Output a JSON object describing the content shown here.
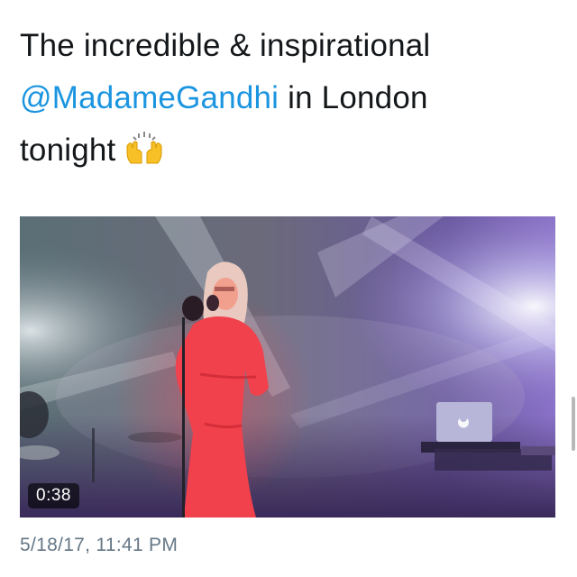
{
  "tweet": {
    "text_part1": "The incredible & inspirational",
    "mention": "@MadameGandhi",
    "text_part2": " in London",
    "text_part3": "tonight",
    "emoji_icon": "raised-hands-icon"
  },
  "media": {
    "type": "video",
    "duration": "0:38"
  },
  "timestamp": "5/18/17, 11:41 PM",
  "colors": {
    "text": "#14171a",
    "mention": "#1b95e0",
    "meta": "#657786",
    "background": "#ffffff"
  }
}
